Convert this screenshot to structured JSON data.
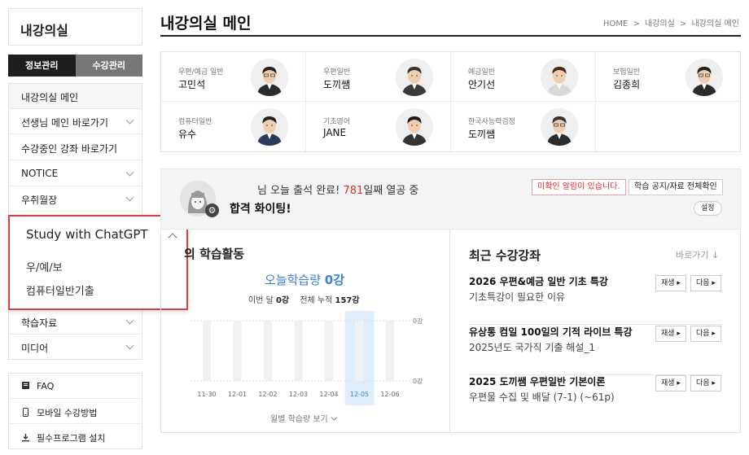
{
  "sidebar": {
    "title": "내강의실",
    "tabs": [
      {
        "label": "정보관리",
        "active": true
      },
      {
        "label": "수강관리",
        "active": false
      }
    ],
    "menu": [
      {
        "label": "내강의실 메인",
        "chevron": false,
        "active": true
      },
      {
        "label": "선생님 메인 바로가기",
        "chevron": true
      },
      {
        "label": "수강중인 강좌 바로가기",
        "chevron": false
      },
      {
        "label": "NOTICE",
        "chevron": true
      },
      {
        "label": "우취월장",
        "chevron": true
      },
      {
        "label": "학습자료",
        "chevron": true
      },
      {
        "label": "미디어",
        "chevron": true
      }
    ],
    "bottom": [
      {
        "label": "FAQ",
        "icon": "book-icon"
      },
      {
        "label": "모바일 수강방법",
        "icon": "mobile-icon"
      },
      {
        "label": "필수프로그램 설치",
        "icon": "download-icon"
      }
    ],
    "popup": {
      "title": "Study with ChatGPT",
      "items": [
        "우/예/보",
        "컴퓨터일반기출"
      ]
    }
  },
  "header": {
    "title": "내강의실 메인",
    "breadcrumb": [
      "HOME",
      ">",
      "내강의실",
      ">",
      "내강의실 메인"
    ]
  },
  "teachers": [
    {
      "subject": "우편/예금 일반",
      "name": "고민석"
    },
    {
      "subject": "우편일반",
      "name": "도끼쌤"
    },
    {
      "subject": "예금일반",
      "name": "안기선"
    },
    {
      "subject": "보험일반",
      "name": "김종희"
    },
    {
      "subject": "컴퓨터일반",
      "name": "유수"
    },
    {
      "subject": "기초영어",
      "name": "JANE"
    },
    {
      "subject": "한국사능력검정",
      "name": "도끼쌤"
    }
  ],
  "attendance": {
    "line_prefix": "님 오늘 출석 완료!",
    "streak_days": "781",
    "line_suffix": "일째 열공 중",
    "cheer": "합격 화이팅!",
    "alert_button": "미확인 알람이 있습니다.",
    "notice_button": "학습 공지/자료 전체확인",
    "setting_button": "설정"
  },
  "activity": {
    "title": "의 학습활동",
    "today_label": "오늘학습량",
    "today_value": "0강",
    "month_label": "이번 달",
    "month_value": "0강",
    "total_label": "전체 누적",
    "total_value": "157강",
    "monthly_link": "월별 학습량 보기"
  },
  "chart_data": {
    "type": "bar",
    "categories": [
      "11-30",
      "12-01",
      "12-02",
      "12-03",
      "12-04",
      "12-05",
      "12-06"
    ],
    "values": [
      0,
      0,
      0,
      0,
      0,
      0,
      0
    ],
    "y_tick_labels": [
      "0강",
      "0강"
    ],
    "highlight_category": "12-05",
    "colors": {
      "highlight": "#dfeefc",
      "highlight_text": "#3a7fd8"
    }
  },
  "recent": {
    "title": "최근 수강강좌",
    "link": "바로가기 ↓",
    "courses": [
      {
        "title": "2026 우편&예금 일반 기초 특강",
        "subtitle": "기초특강이 필요한 이유",
        "play": "재생 ▸",
        "next": "다음 ▸"
      },
      {
        "title": "유상통 컴일 100일의 기적 라이브 특강",
        "subtitle": "2025년도 국가직 기출 해설_1",
        "play": "재생 ▸",
        "next": "다음 ▸"
      },
      {
        "title": "2025 도끼쌤 우편일반 기본이론",
        "subtitle": "우편물 수집 및 배달 (7-1) (~61p)",
        "play": "재생 ▸",
        "next": "다음 ▸"
      }
    ]
  }
}
